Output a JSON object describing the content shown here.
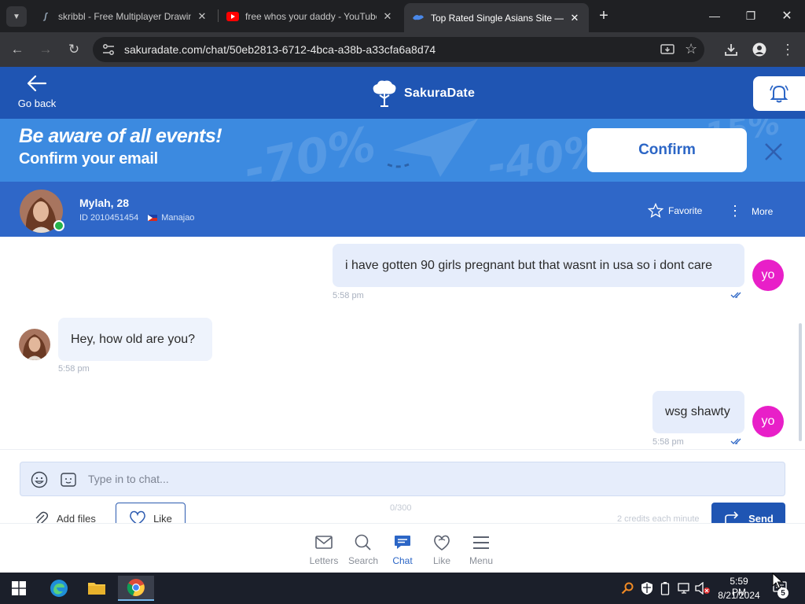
{
  "browser": {
    "tabs": [
      {
        "title": "skribbl - Free Multiplayer Drawing",
        "active": false
      },
      {
        "title": "free whos your daddy - YouTube",
        "active": false
      },
      {
        "title": "Top Rated Single Asians Site —",
        "active": true
      }
    ],
    "url": "sakuradate.com/chat/50eb2813-6712-4bca-a38b-a33cfa6a8d74"
  },
  "site": {
    "go_back_label": "Go back",
    "brand": "SakuraDate",
    "brand_color": "#1f55b3"
  },
  "banner": {
    "title": "Be aware of all events!",
    "subtitle": "Confirm your email",
    "confirm_label": "Confirm",
    "deco": [
      "-70%",
      "-40%",
      "-15%"
    ]
  },
  "profile": {
    "name": "Mylah, 28",
    "id_text": "ID 2010451454",
    "location": "Manajao",
    "favorite_label": "Favorite",
    "more_label": "More"
  },
  "messages": [
    {
      "direction": "out",
      "text": "i have gotten 90 girls pregnant but that wasnt in usa so i dont care",
      "time": "5:58 pm",
      "avatar_text": "yo"
    },
    {
      "direction": "in",
      "text": "Hey, how old are you?",
      "time": "5:58 pm"
    },
    {
      "direction": "out",
      "text": "wsg shawty",
      "time": "5:58 pm",
      "avatar_text": "yo"
    }
  ],
  "composer": {
    "placeholder": "Type in to chat...",
    "char_count": "0/300",
    "add_files_label": "Add files",
    "like_label": "Like",
    "credits_text": "2 credits each minute",
    "send_label": "Send"
  },
  "bottom_nav": [
    {
      "label": "Letters",
      "icon": "mail-icon",
      "active": false
    },
    {
      "label": "Search",
      "icon": "search-icon",
      "active": false
    },
    {
      "label": "Chat",
      "icon": "chat-icon",
      "active": true
    },
    {
      "label": "Like",
      "icon": "heart-icon",
      "active": false
    },
    {
      "label": "Menu",
      "icon": "menu-icon",
      "active": false
    }
  ],
  "taskbar": {
    "time": "5:59 PM",
    "date": "8/21/2024",
    "notification_count": "5"
  }
}
